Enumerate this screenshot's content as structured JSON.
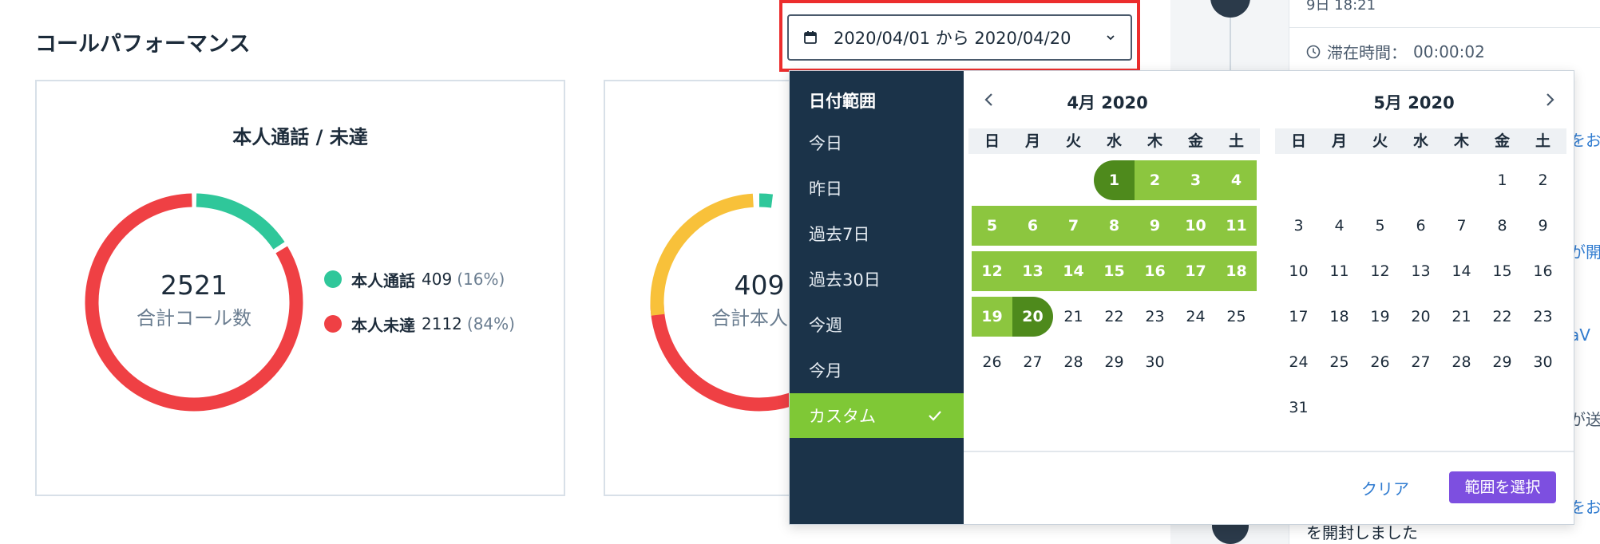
{
  "page": {
    "title": "コールパフォーマンス"
  },
  "range_button": {
    "label": "2020/04/01 から 2020/04/20"
  },
  "card1": {
    "title": "本人通話 / 未達",
    "center_value": "2521",
    "center_label": "合計コール数",
    "legend": [
      {
        "name": "本人通話",
        "value": "409",
        "pct": "(16%)",
        "color": "#2fc79a"
      },
      {
        "name": "本人未達",
        "value": "2112",
        "pct": "(84%)",
        "color": "#ef4044"
      }
    ],
    "segments": [
      {
        "label": "本人通話",
        "fraction": 0.16,
        "color": "#2fc79a"
      },
      {
        "label": "本人未達",
        "fraction": 0.84,
        "color": "#ef4044"
      }
    ]
  },
  "card2": {
    "center_value": "409",
    "center_label": "合計本人通",
    "segments": [
      {
        "fraction": 0.02,
        "color": "#2fc79a"
      },
      {
        "fraction": 0.45,
        "color": "#ef4044"
      },
      {
        "fraction": 0.26,
        "color": "#f8c13a"
      }
    ]
  },
  "picker": {
    "heading": "日付範囲",
    "presets": [
      "今日",
      "昨日",
      "過去7日",
      "過去30日",
      "今週",
      "今月",
      "カスタム"
    ],
    "active_preset": "カスタム",
    "weekdays": [
      "日",
      "月",
      "火",
      "水",
      "木",
      "金",
      "土"
    ],
    "months": [
      {
        "title": "4月 2020",
        "first_weekday": 3,
        "days": 30,
        "range_start": 1,
        "range_end": 20
      },
      {
        "title": "5月 2020",
        "first_weekday": 5,
        "days": 31,
        "range_start": 0,
        "range_end": 0
      }
    ],
    "clear_label": "クリア",
    "apply_label": "範囲を選択"
  },
  "timeline": {
    "top_fragment": "9日 18:21",
    "dwell_label": "滞在時間：",
    "dwell_value": "00:00:02",
    "fragments": [
      "をお",
      "が開",
      "aV",
      "が送",
      "をお"
    ],
    "bottom_text": "を開封しました"
  },
  "colors": {
    "accent_green": "#8cc63f",
    "endpoint_green": "#4e8a1c",
    "preset_bg": "#1b3349",
    "apply_purple": "#7d4fe0",
    "highlight_red": "#ec2d2d"
  }
}
